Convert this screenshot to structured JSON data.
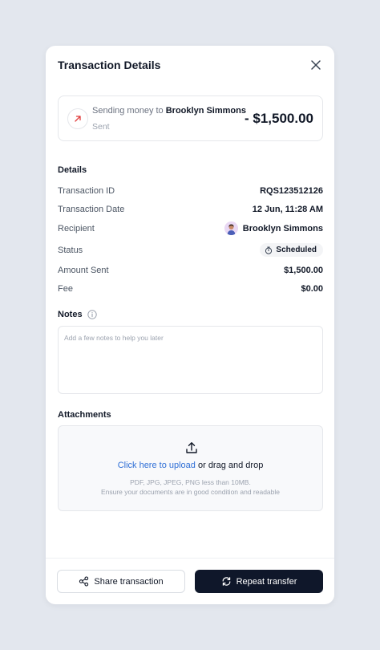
{
  "header": {
    "title": "Transaction Details"
  },
  "summary": {
    "prefix": "Sending money to",
    "recipient": "Brooklyn Simmons",
    "status": "Sent",
    "amount": "- $1,500.00",
    "arrow_color": "#e03b3b"
  },
  "details": {
    "heading": "Details",
    "rows": {
      "transaction_id": {
        "label": "Transaction ID",
        "value": "RQS123512126"
      },
      "transaction_date": {
        "label": "Transaction Date",
        "value": "12 Jun, 11:28 AM"
      },
      "recipient": {
        "label": "Recipient",
        "value": "Brooklyn Simmons"
      },
      "status": {
        "label": "Status",
        "value": "Scheduled"
      },
      "amount_sent": {
        "label": "Amount Sent",
        "value": "$1,500.00"
      },
      "fee": {
        "label": "Fee",
        "value": "$0.00"
      }
    }
  },
  "notes": {
    "label": "Notes",
    "placeholder": "Add a few notes to help you later"
  },
  "attachments": {
    "label": "Attachments",
    "link_text": "Click here to upload",
    "rest_text": " or drag and drop",
    "hint1": "PDF, JPG, JPEG, PNG less than 10MB.",
    "hint2": "Ensure your documents are in good condition and readable"
  },
  "footer": {
    "share_label": "Share transaction",
    "repeat_label": "Repeat transfer"
  },
  "colors": {
    "link": "#2f6fd6",
    "primary_button": "#0f172a",
    "background": "#e3e7ee"
  }
}
